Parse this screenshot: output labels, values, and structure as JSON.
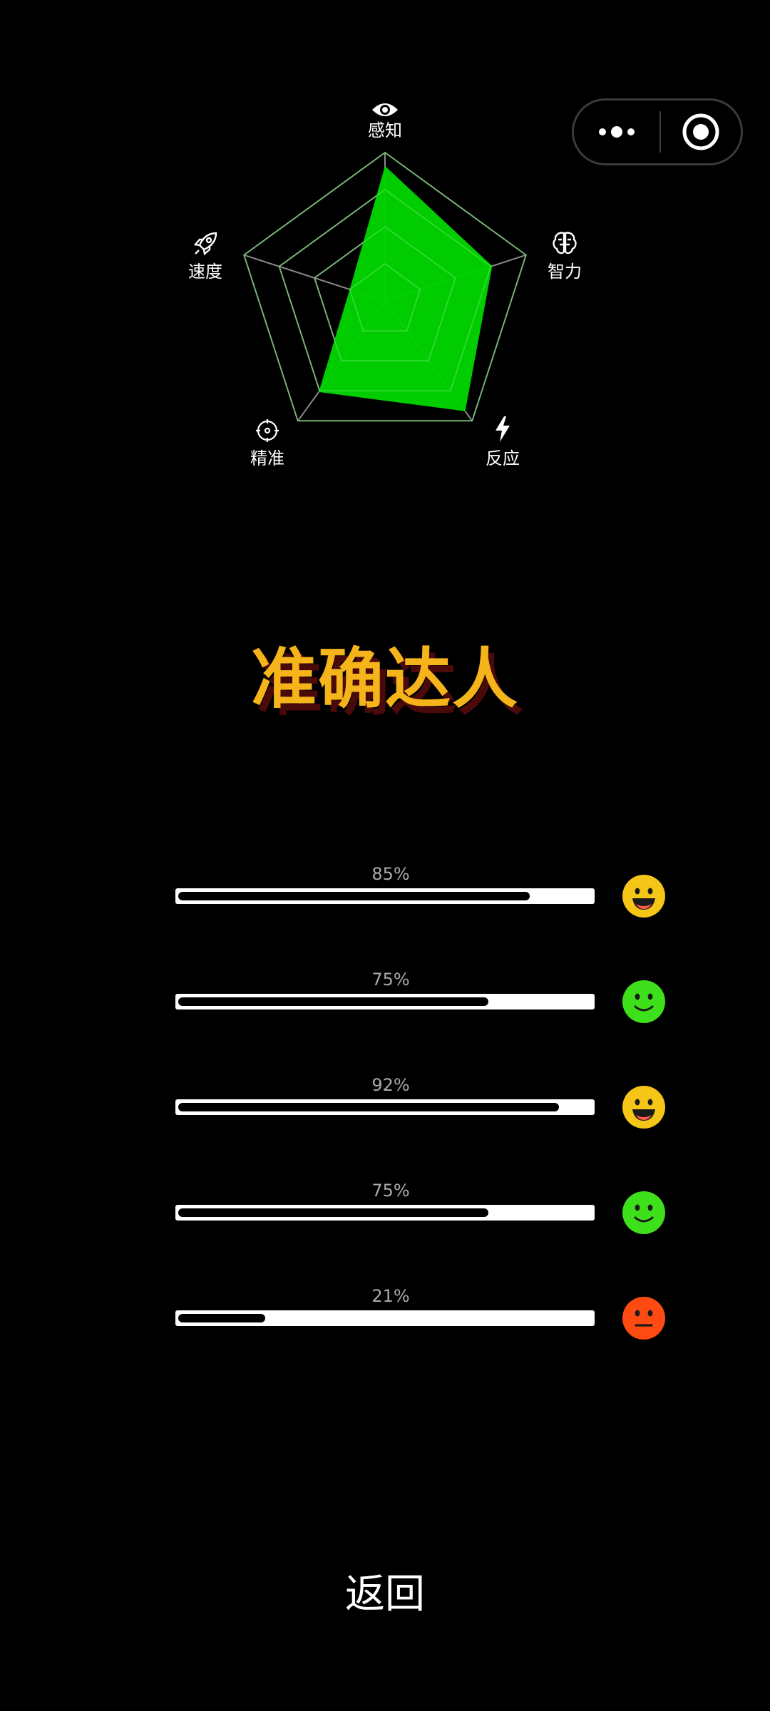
{
  "capsule": {
    "more_icon": "more-dots-icon",
    "close_icon": "close-target-icon"
  },
  "chart_data": {
    "type": "radar",
    "axes": [
      "感知",
      "智力",
      "反应",
      "精准",
      "速度"
    ],
    "axis_icons": [
      "eye-icon",
      "brain-icon",
      "lightning-icon",
      "crosshair-icon",
      "rocket-icon"
    ],
    "values": [
      0.91,
      0.76,
      0.92,
      0.76,
      0.25
    ],
    "rings": 4,
    "fill_color": "#00d400",
    "grid_color": "#8a8a8a"
  },
  "title": "准确达人",
  "progress": [
    {
      "value": 85,
      "label": "85%",
      "mood": "laughing",
      "color": "#f5c518"
    },
    {
      "value": 75,
      "label": "75%",
      "mood": "smiling",
      "color": "#3ee01c"
    },
    {
      "value": 92,
      "label": "92%",
      "mood": "laughing",
      "color": "#f5c518"
    },
    {
      "value": 75,
      "label": "75%",
      "mood": "smiling",
      "color": "#3ee01c"
    },
    {
      "value": 21,
      "label": "21%",
      "mood": "neutral",
      "color": "#ff4a12"
    }
  ],
  "back_label": "返回"
}
